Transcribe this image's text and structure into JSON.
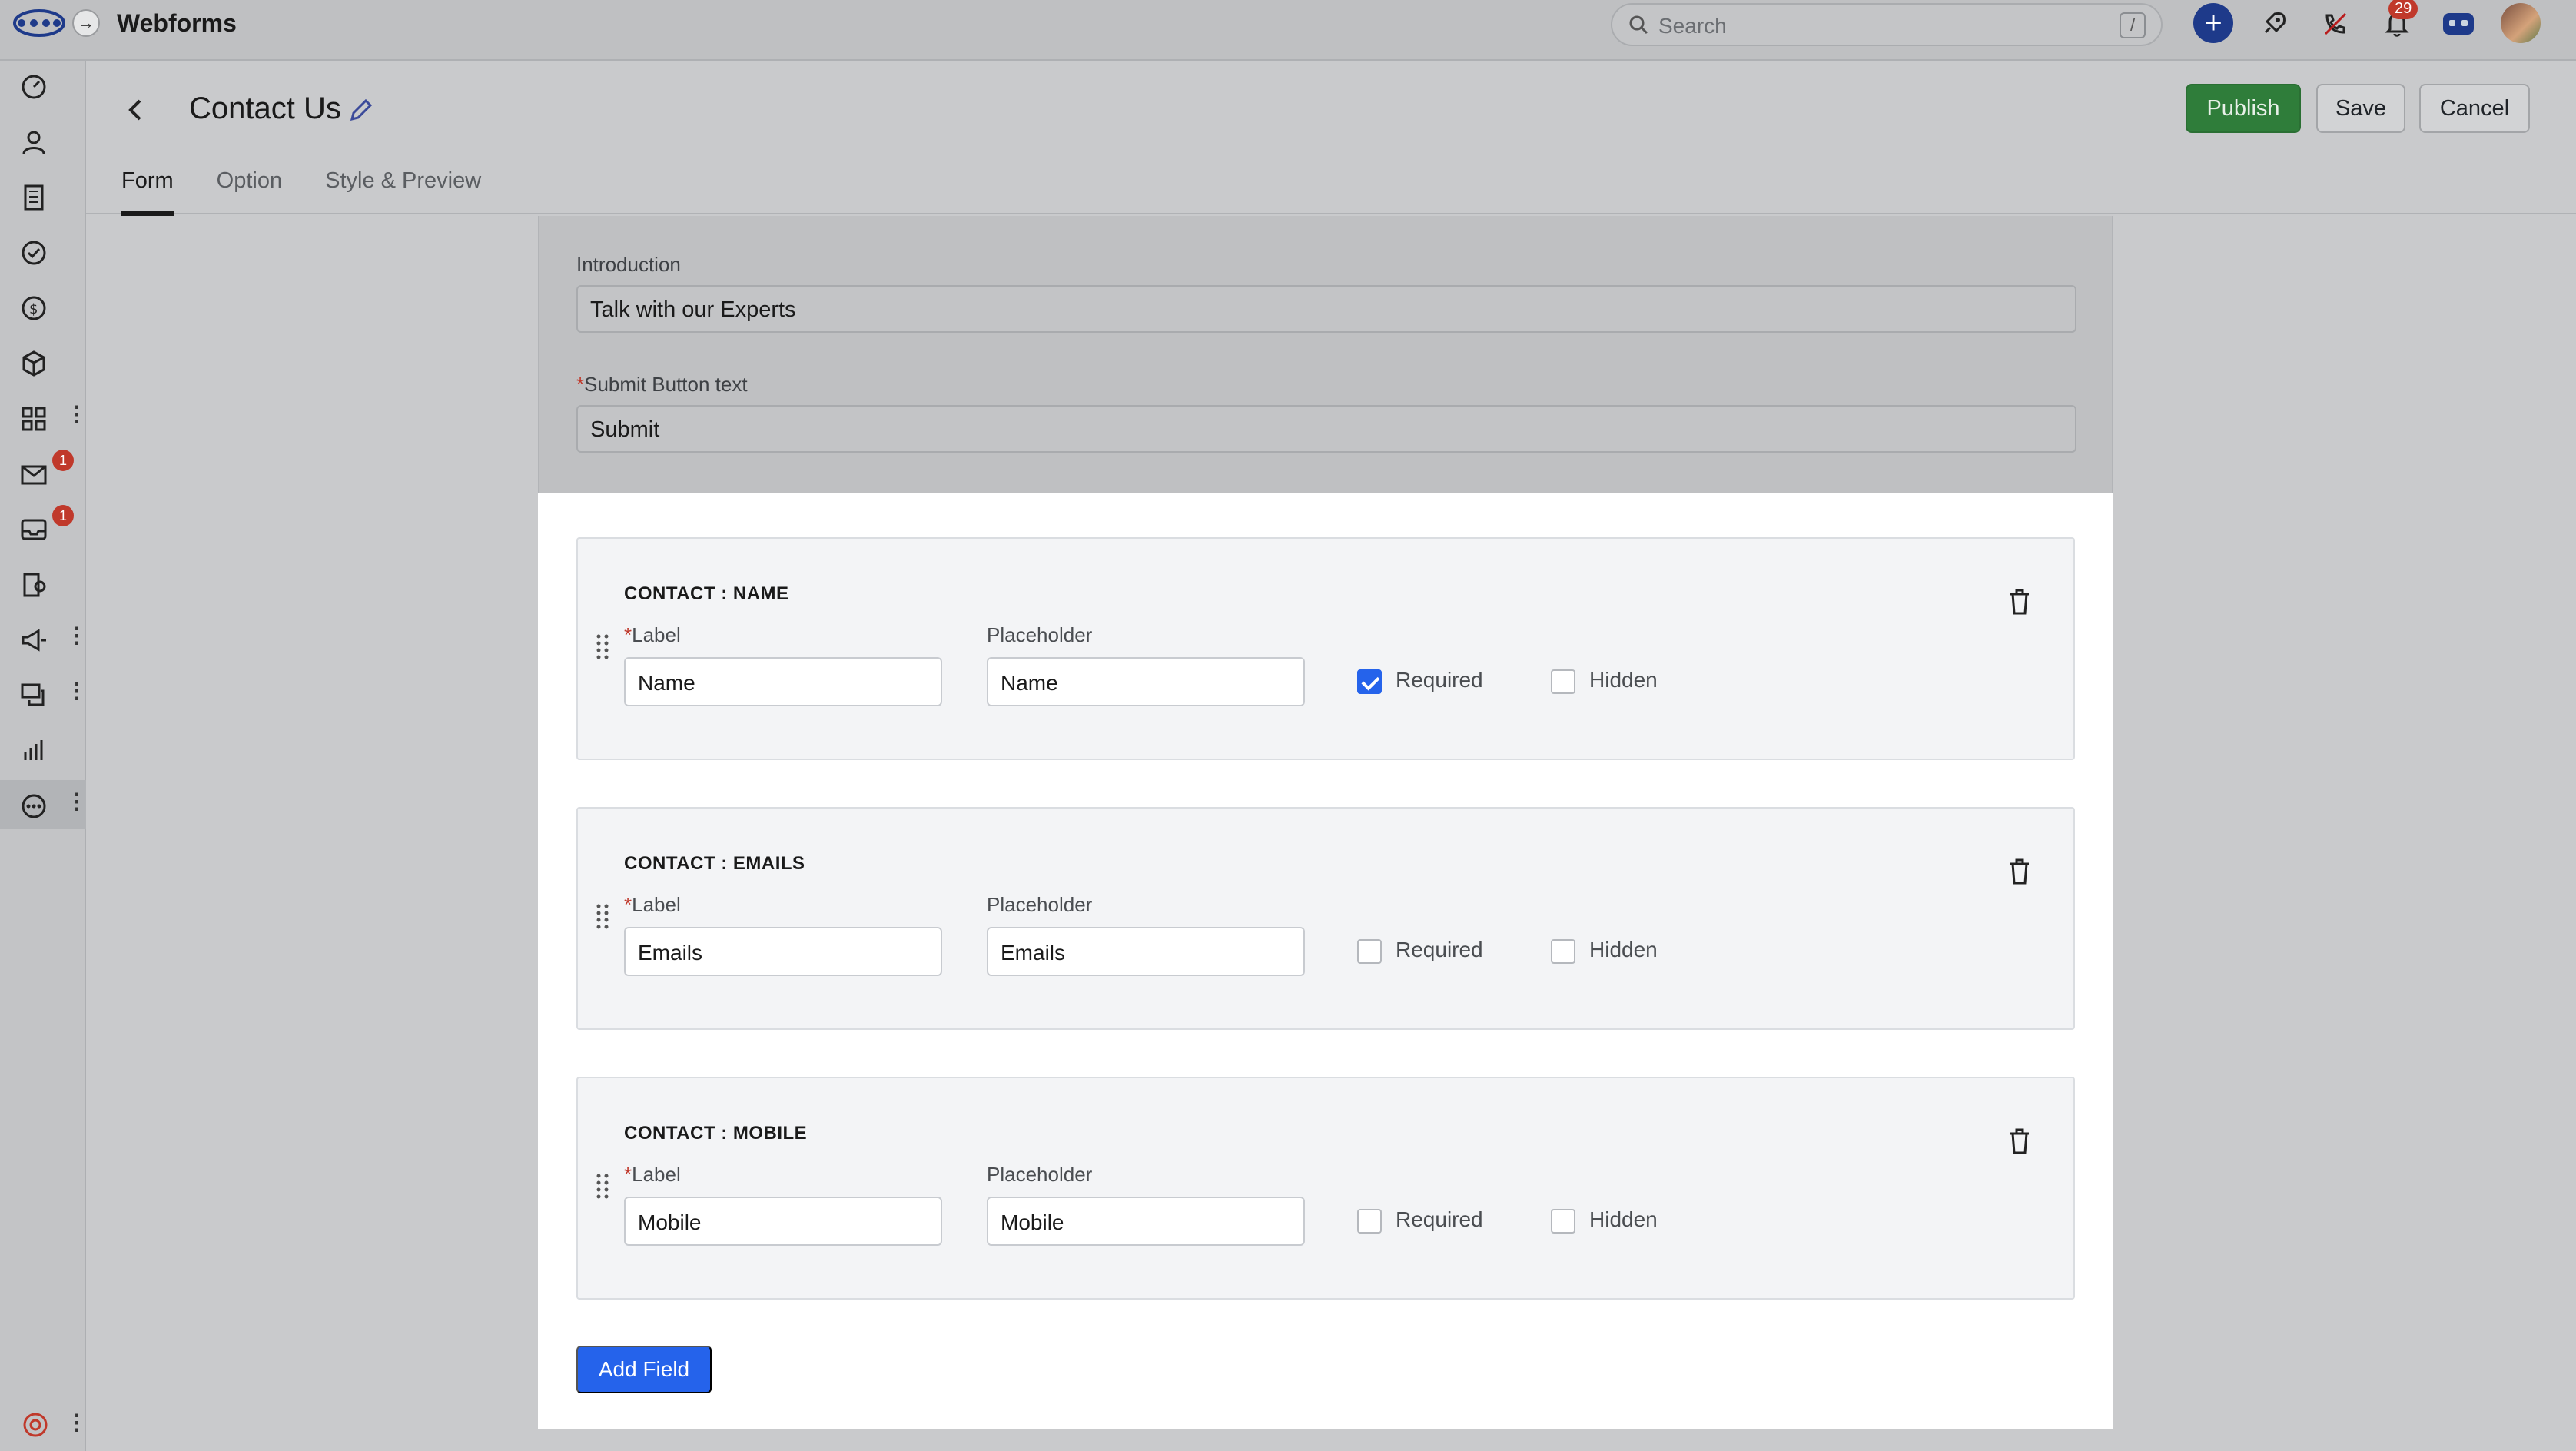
{
  "app": {
    "title": "Webforms"
  },
  "search": {
    "placeholder": "Search",
    "shortcut": "/"
  },
  "topbar": {
    "notification_count": "29"
  },
  "rail": {
    "items": [
      {
        "icon": "dashboard-icon"
      },
      {
        "icon": "contacts-icon"
      },
      {
        "icon": "companies-icon"
      },
      {
        "icon": "tasks-icon"
      },
      {
        "icon": "deals-icon"
      },
      {
        "icon": "products-icon"
      },
      {
        "icon": "apps-icon",
        "more": true
      },
      {
        "icon": "mail-icon",
        "badge": "1"
      },
      {
        "icon": "inbox-icon",
        "badge": "1"
      },
      {
        "icon": "documents-icon"
      },
      {
        "icon": "campaigns-icon",
        "more": true
      },
      {
        "icon": "chat-icon",
        "more": true
      },
      {
        "icon": "reports-icon"
      },
      {
        "icon": "more-options-icon",
        "more": true,
        "active": true
      }
    ]
  },
  "header": {
    "title": "Contact Us",
    "publish": "Publish",
    "save": "Save",
    "cancel": "Cancel",
    "tabs": [
      "Form",
      "Option",
      "Style & Preview"
    ],
    "active_tab": "Form"
  },
  "form": {
    "introduction_label": "Introduction",
    "introduction_value": "Talk with our Experts",
    "submit_required_mark": "*",
    "submit_label": "Submit Button text",
    "submit_value": "Submit"
  },
  "fields": [
    {
      "title": "CONTACT : NAME",
      "label_required_mark": "*",
      "label_caption": "Label",
      "label_value": "Name",
      "placeholder_caption": "Placeholder",
      "placeholder_value": "Name",
      "required_text": "Required",
      "required": true,
      "hidden_text": "Hidden",
      "hidden": false
    },
    {
      "title": "CONTACT : EMAILS",
      "label_required_mark": "*",
      "label_caption": "Label",
      "label_value": "Emails",
      "placeholder_caption": "Placeholder",
      "placeholder_value": "Emails",
      "required_text": "Required",
      "required": false,
      "hidden_text": "Hidden",
      "hidden": false
    },
    {
      "title": "CONTACT : MOBILE",
      "label_required_mark": "*",
      "label_caption": "Label",
      "label_value": "Mobile",
      "placeholder_caption": "Placeholder",
      "placeholder_value": "Mobile",
      "required_text": "Required",
      "required": false,
      "hidden_text": "Hidden",
      "hidden": false
    }
  ],
  "add_field": "Add Field",
  "colors": {
    "publish": "#2f7d3a",
    "primary": "#2563eb",
    "badge": "#c0392b"
  }
}
